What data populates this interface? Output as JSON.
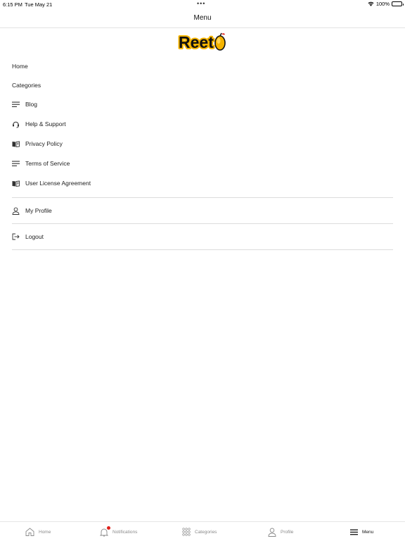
{
  "status_bar": {
    "time": "6:15 PM",
    "date": "Tue May 21",
    "dots": "•••",
    "battery": "100%"
  },
  "nav": {
    "title": "Menu"
  },
  "logo": {
    "text": "Reet",
    "brand_color": "#f5b400"
  },
  "menu": {
    "top_items": [
      {
        "label": "Home"
      },
      {
        "label": "Categories"
      }
    ],
    "icon_items": [
      {
        "label": "Blog",
        "icon": "lines-icon"
      },
      {
        "label": "Help & Support",
        "icon": "headset-icon"
      },
      {
        "label": "Privacy Policy",
        "icon": "book-icon"
      },
      {
        "label": "Terms of Service",
        "icon": "lines-icon"
      },
      {
        "label": "User License Agreement",
        "icon": "book-icon"
      }
    ],
    "profile": {
      "label": "My Profile",
      "icon": "person-icon"
    },
    "logout": {
      "label": "Logout",
      "icon": "logout-icon"
    }
  },
  "tab_bar": {
    "tabs": [
      {
        "label": "Home",
        "icon": "home-icon",
        "active": false
      },
      {
        "label": "Notifications",
        "icon": "bell-icon",
        "active": false,
        "badge": true
      },
      {
        "label": "Categories",
        "icon": "grid-icon",
        "active": false
      },
      {
        "label": "Profile",
        "icon": "person-icon",
        "active": false
      },
      {
        "label": "Menu",
        "icon": "hamburger-icon",
        "active": true
      }
    ],
    "badge_color": "#e0201b"
  }
}
